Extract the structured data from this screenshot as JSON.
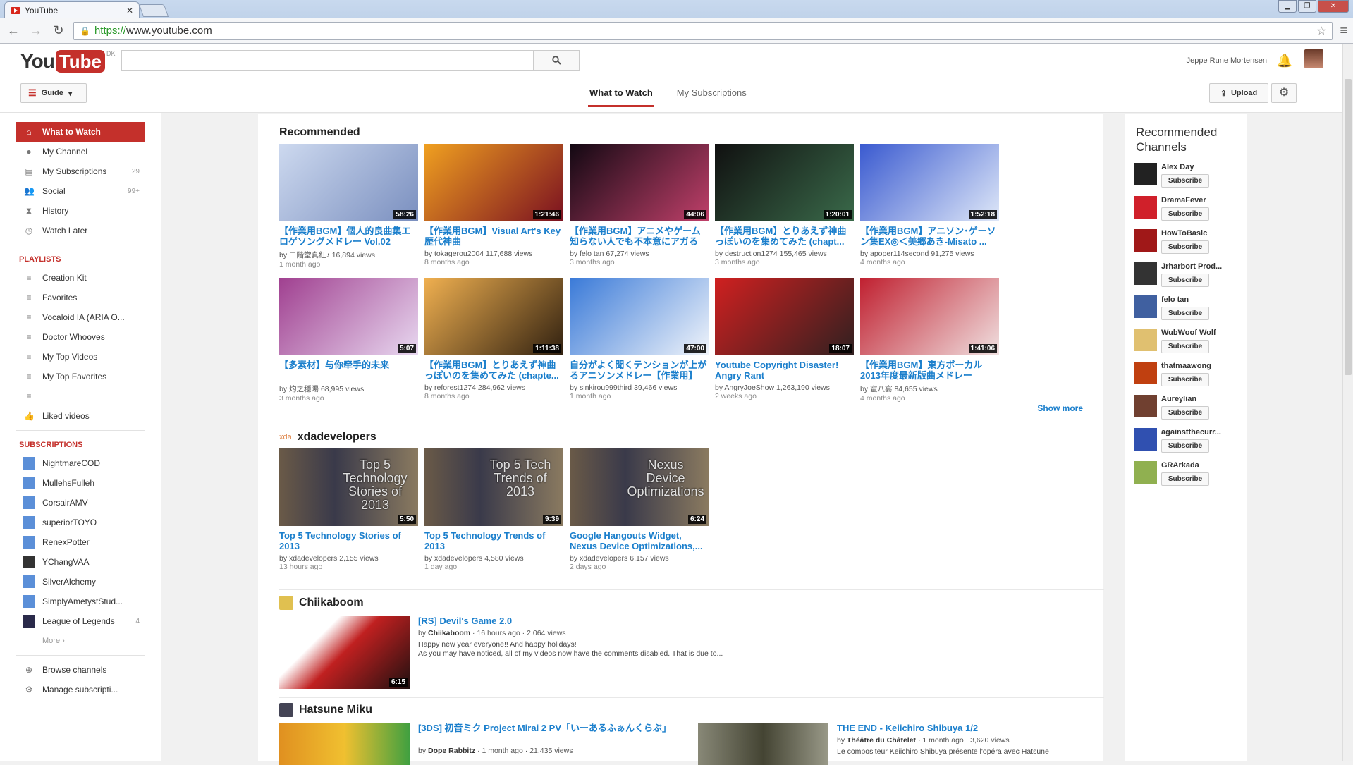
{
  "browser": {
    "tab_title": "YouTube",
    "url_proto": "https://",
    "url_rest": "www.youtube.com"
  },
  "header": {
    "logo_you": "You",
    "logo_tube": "Tube",
    "country": "DK",
    "user": "Jeppe Rune Mortensen",
    "guide_label": "Guide",
    "upload_label": "Upload",
    "tabs": [
      "What to Watch",
      "My Subscriptions"
    ]
  },
  "sidebar": {
    "main": [
      {
        "label": "What to Watch",
        "icon": "home-icon"
      },
      {
        "label": "My Channel",
        "icon": "user-icon",
        "count": ""
      },
      {
        "label": "My Subscriptions",
        "icon": "subscriptions-icon",
        "count": "29"
      },
      {
        "label": "Social",
        "icon": "social-icon",
        "count": "99+"
      },
      {
        "label": "History",
        "icon": "hourglass-icon"
      },
      {
        "label": "Watch Later",
        "icon": "clock-icon"
      }
    ],
    "playlists_head": "PLAYLISTS",
    "playlists": [
      "Creation Kit",
      "Favorites",
      "Vocaloid IA (ARIA O...",
      "Doctor Whooves",
      "My Top Videos",
      "My Top Favorites",
      "",
      "Liked videos"
    ],
    "subs_head": "SUBSCRIPTIONS",
    "subs": [
      {
        "label": "NightmareCOD",
        "count": ""
      },
      {
        "label": "MullehsFulleh",
        "count": ""
      },
      {
        "label": "CorsairAMV",
        "count": ""
      },
      {
        "label": "superiorTOYO",
        "count": ""
      },
      {
        "label": "RenexPotter",
        "count": ""
      },
      {
        "label": "YChangVAA",
        "count": ""
      },
      {
        "label": "SilverAlchemy",
        "count": ""
      },
      {
        "label": "SimplyAmetystStud...",
        "count": ""
      },
      {
        "label": "League of Legends",
        "count": "4"
      }
    ],
    "more": "More ›",
    "bottom": [
      "Browse channels",
      "Manage subscripti..."
    ]
  },
  "recommended": {
    "title": "Recommended",
    "show_more": "Show more",
    "videos": [
      {
        "title": "【作業用BGM】個人的良曲集エロゲソングメドレー Vol.02",
        "by": "by 二階堂真紅♪",
        "views": "16,894 views",
        "age": "1 month ago",
        "dur": "58:26",
        "c": [
          "#cdd9ef",
          "#7a8fbf"
        ]
      },
      {
        "title": "【作業用BGM】Visual Art's Key 歴代神曲",
        "by": "by tokagerou2004",
        "views": "117,688 views",
        "age": "8 months ago",
        "dur": "1:21:46",
        "c": [
          "#f0a020",
          "#7a1020"
        ]
      },
      {
        "title": "【作業用BGM】アニメやゲーム知らない人でも不本意にアガるBG...",
        "by": "by felo tan",
        "views": "67,274 views",
        "age": "3 months ago",
        "dur": "44:06",
        "c": [
          "#120812",
          "#c0406a"
        ]
      },
      {
        "title": "【作業用BGM】とりあえず神曲っぽいのを集めてみた (chapt...",
        "by": "by destruction1274",
        "views": "155,465 views",
        "age": "3 months ago",
        "dur": "1:20:01",
        "c": [
          "#101010",
          "#3a6a4a"
        ]
      },
      {
        "title": "【作業用BGM】アニソン･ゲーソン集EX◎＜美郷あき-Misato ...",
        "by": "by apoper114second",
        "views": "91,275 views",
        "age": "4 months ago",
        "dur": "1:52:18",
        "c": [
          "#3a5ad0",
          "#dfe8f8"
        ]
      },
      {
        "title": "【多素材】与你牵手的未来",
        "by": "by 灼之穩陽",
        "views": "68,995 views",
        "age": "3 months ago",
        "dur": "5:07",
        "c": [
          "#a04090",
          "#e8d8f0"
        ]
      },
      {
        "title": "【作業用BGM】とりあえず神曲っぽいのを集めてみた (chapte...",
        "by": "by reforest1274",
        "views": "284,962 views",
        "age": "8 months ago",
        "dur": "1:11:38",
        "c": [
          "#f0b050",
          "#302010"
        ]
      },
      {
        "title": "自分がよく聞くテンションが上がるアニソンメドレー【作業用】",
        "by": "by sinkirou999third",
        "views": "39,466 views",
        "age": "1 month ago",
        "dur": "47:00",
        "c": [
          "#3a7ad8",
          "#f0f4fa"
        ]
      },
      {
        "title": "Youtube Copyright Disaster! Angry Rant",
        "by": "by AngryJoeShow",
        "views": "1,263,190 views",
        "age": "2 weeks ago",
        "dur": "18:07",
        "c": [
          "#d02020",
          "#302020"
        ]
      },
      {
        "title": "【作業用BGM】東方ボーカル2013年度最新版曲メドレー",
        "by": "by 蜜八宴",
        "views": "84,655 views",
        "age": "4 months ago",
        "dur": "1:41:06",
        "c": [
          "#c02030",
          "#f0e0e0"
        ]
      }
    ]
  },
  "xda": {
    "icon_text": "xda",
    "title": "xdadevelopers",
    "videos": [
      {
        "title": "Top 5 Technology Stories of 2013",
        "by": "by xdadevelopers",
        "views": "2,155 views",
        "age": "13 hours ago",
        "dur": "5:50",
        "overlay": "Top 5 Technology Stories of 2013"
      },
      {
        "title": "Top 5 Technology Trends of 2013",
        "by": "by xdadevelopers",
        "views": "4,580 views",
        "age": "1 day ago",
        "dur": "9:39",
        "overlay": "Top 5 Tech Trends of 2013"
      },
      {
        "title": "Google Hangouts Widget, Nexus Device Optimizations,...",
        "by": "by xdadevelopers",
        "views": "6,157 views",
        "age": "2 days ago",
        "dur": "6:24",
        "overlay": "Nexus Device Optimizations"
      }
    ]
  },
  "chiika": {
    "title": "Chiikaboom",
    "video": {
      "title": "[RS] Devil's Game 2.0",
      "by": "by",
      "channel": "Chiikaboom",
      "age": "16 hours ago",
      "views": "2,064 views",
      "desc1": "Happy new year everyone!! And happy holidays!",
      "desc2": "As you may have noticed, all of my videos now have the comments disabled. That is due to...",
      "dur": "6:15"
    }
  },
  "miku": {
    "title": "Hatsune Miku",
    "videos": [
      {
        "title": "[3DS] 初音ミク Project Mirai 2 PV「いーあるふぁんくらぶ」",
        "by": "by",
        "channel": "Dope Rabbitz",
        "age": "1 month ago",
        "views": "21,435 views"
      },
      {
        "title": "THE END - Keiichiro Shibuya 1/2",
        "by": "by",
        "channel": "Théâtre du Châtelet",
        "age": "1 month ago",
        "views": "3,620 views",
        "desc": "Le compositeur Keiichiro Shibuya présente l'opéra avec Hatsune"
      }
    ]
  },
  "right": {
    "title": "Recommended Channels",
    "subscribe": "Subscribe",
    "channels": [
      {
        "name": "Alex Day",
        "c": "#222"
      },
      {
        "name": "DramaFever",
        "c": "#d0202a"
      },
      {
        "name": "HowToBasic",
        "c": "#a01818"
      },
      {
        "name": "Jrharbort Prod...",
        "c": "#333"
      },
      {
        "name": "felo tan",
        "c": "#4060a0"
      },
      {
        "name": "WubWoof Wolf",
        "c": "#e0c070"
      },
      {
        "name": "thatmaawong",
        "c": "#c04010"
      },
      {
        "name": "Aureylian",
        "c": "#704030"
      },
      {
        "name": "againstthecurr...",
        "c": "#3050b0"
      },
      {
        "name": "GRArkada",
        "c": "#90b050"
      }
    ]
  },
  "colors": {
    "accent": "#c4302b",
    "link": "#1b7fcc"
  }
}
